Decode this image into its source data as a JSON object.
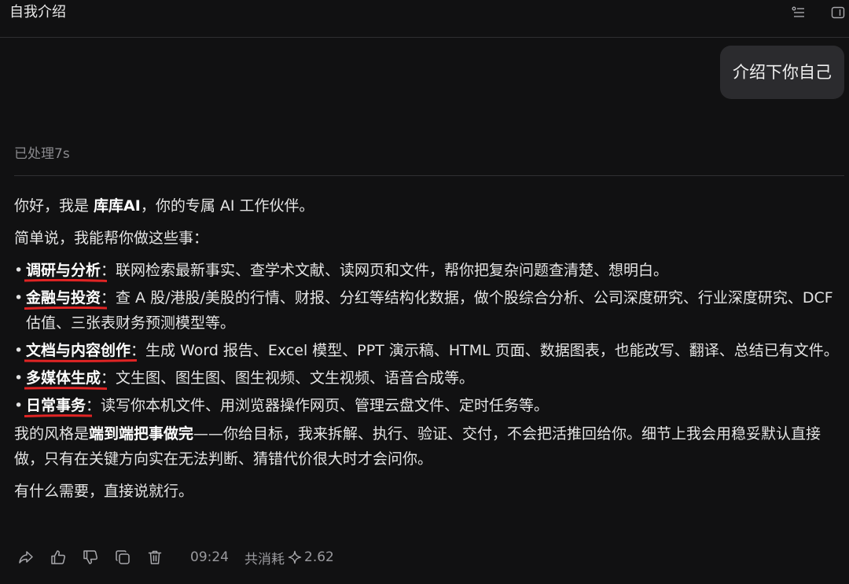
{
  "header": {
    "title": "自我介绍",
    "icons": [
      "list-icon",
      "sidebar-panel-icon"
    ]
  },
  "conversation": {
    "user_message": "介绍下你自己",
    "processed_label": "已处理7s",
    "answer": {
      "greeting_pre": "你好，我是 ",
      "assistant_name": "库库AI",
      "greeting_post": "，你的专属 AI 工作伙伴。",
      "intro": "简单说，我能帮你做这些事：",
      "capabilities": [
        {
          "name": "调研与分析",
          "desc": "：联网检索最新事实、查学术文献、读网页和文件，帮你把复杂问题查清楚、想明白。"
        },
        {
          "name": "金融与投资",
          "desc": "：查 A 股/港股/美股的行情、财报、分红等结构化数据，做个股综合分析、公司深度研究、行业深度研究、DCF 估值、三张表财务预测模型等。"
        },
        {
          "name": "文档与内容创作",
          "desc": "：生成 Word 报告、Excel 模型、PPT 演示稿、HTML 页面、数据图表，也能改写、翻译、总结已有文件。"
        },
        {
          "name": "多媒体生成",
          "desc": "：文生图、图生图、图生视频、文生视频、语音合成等。"
        },
        {
          "name": "日常事务",
          "desc": "：读写你本机文件、用浏览器操作网页、管理云盘文件、定时任务等。"
        }
      ],
      "style_pre": "我的风格是",
      "style_bold": "端到端把事做完",
      "style_post": "——你给目标，我来拆解、执行、验证、交付，不会把活推回给你。细节上我会用稳妥默认直接做，只有在关键方向实在无法判断、猜错代价很大时才会问你。",
      "closing": "有什么需要，直接说就行。"
    },
    "footer": {
      "icons": [
        "share-icon",
        "thumbs-up-icon",
        "thumbs-down-icon",
        "copy-icon",
        "delete-icon"
      ],
      "time": "09:24",
      "cost_label": "共消耗",
      "cost_value": "2.62"
    }
  },
  "colors": {
    "background": "#111112",
    "bubble": "#2b2b2e",
    "underline": "#e02424",
    "muted": "#8a8a8e"
  }
}
